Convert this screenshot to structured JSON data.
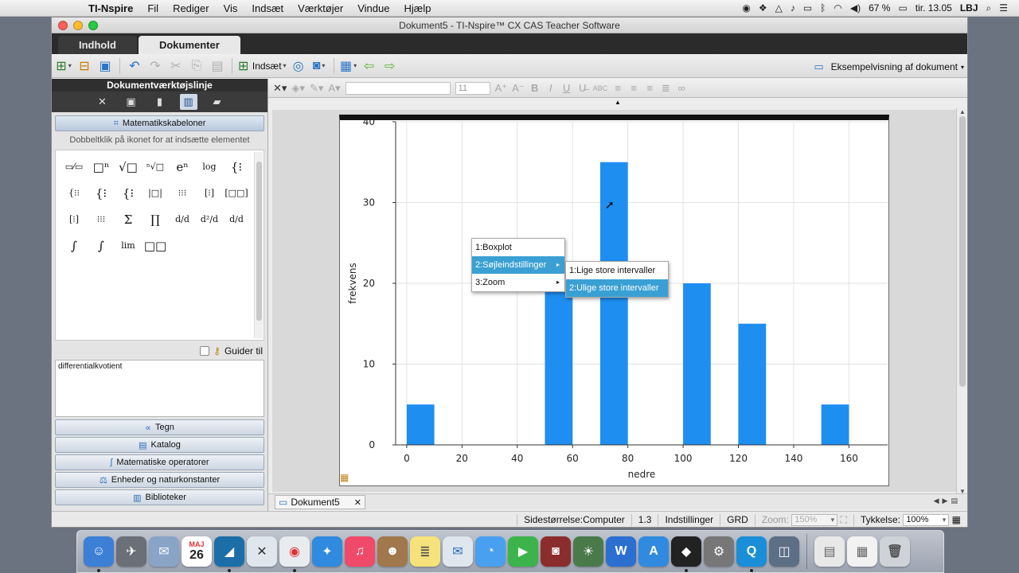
{
  "menubar": {
    "app_name": "TI-Nspire",
    "items": [
      "Fil",
      "Rediger",
      "Vis",
      "Indsæt",
      "Værktøjer",
      "Vindue",
      "Hjælp"
    ],
    "battery": "67 %",
    "clock": "tir. 13.05",
    "user": "LBJ"
  },
  "window": {
    "title": "Dokument5 - TI-Nspire™ CX CAS Teacher Software",
    "tabs": [
      "Indhold",
      "Dokumenter"
    ]
  },
  "toolbar": {
    "insert_label": "Indsæt",
    "preview_label": "Eksempelvisning af dokument"
  },
  "leftpanel": {
    "title": "Dokumentværktøjslinje",
    "section_templates": "Matematikskabeloner",
    "hint": "Dobbeltklik på ikonet for at indsætte elementet",
    "templates": [
      "▭⁄▭",
      "□ⁿ",
      "√□",
      "ⁿ√□",
      "eⁿ",
      "log",
      "{⁝",
      "{⁝⁝",
      "{⁝",
      "{⁝",
      "|□|",
      "⁝⁝⁝",
      "[⁝]",
      "[□□]",
      "[⁝]",
      "⁝⁝⁝",
      "Σ",
      "∏",
      "d/d",
      "d²/d",
      "d/d",
      "∫",
      "∫",
      "lim",
      "□□"
    ],
    "guide_label": "Guider til",
    "description": "differentialkvotient",
    "sections": [
      "Tegn",
      "Katalog",
      "Matematiske operatorer",
      "Enheder og naturkonstanter",
      "Biblioteker"
    ]
  },
  "fmtbar": {
    "font_size": "11"
  },
  "chart_data": {
    "type": "bar",
    "title": "",
    "xlabel": "nedre",
    "ylabel": "frekvens",
    "xlim": [
      -4,
      174
    ],
    "ylim": [
      0,
      40
    ],
    "x_ticks": [
      0,
      20,
      40,
      60,
      80,
      100,
      120,
      140,
      160
    ],
    "y_ticks": [
      0,
      10,
      20,
      30,
      40
    ],
    "bin_width": 10,
    "bins": [
      {
        "x": 0,
        "value": 5
      },
      {
        "x": 50,
        "value": 20
      },
      {
        "x": 70,
        "value": 35
      },
      {
        "x": 100,
        "value": 20
      },
      {
        "x": 120,
        "value": 15
      },
      {
        "x": 150,
        "value": 5
      }
    ],
    "bar_color": "#1f8ef1",
    "grid": true
  },
  "context_menu": {
    "items": [
      "1:Boxplot",
      "2:Søjleindstillinger",
      "3:Zoom"
    ],
    "submenu": [
      "1:Lige store intervaller",
      "2:Ulige store intervaller"
    ]
  },
  "doc_tab": "Dokument5",
  "statusbar": {
    "page_size": "Sidestørrelse:Computer",
    "page": "1.3",
    "settings": "Indstillinger",
    "angle": "GRD",
    "zoom_label": "Zoom:",
    "zoom_value": "150%",
    "thickness_label": "Tykkelse:",
    "thickness_value": "100%"
  },
  "dock": {
    "calendar_month": "MAJ",
    "calendar_day": "26"
  },
  "colors": {
    "accent_highlight": "#3aa0d4",
    "bar": "#1f8ef1"
  }
}
